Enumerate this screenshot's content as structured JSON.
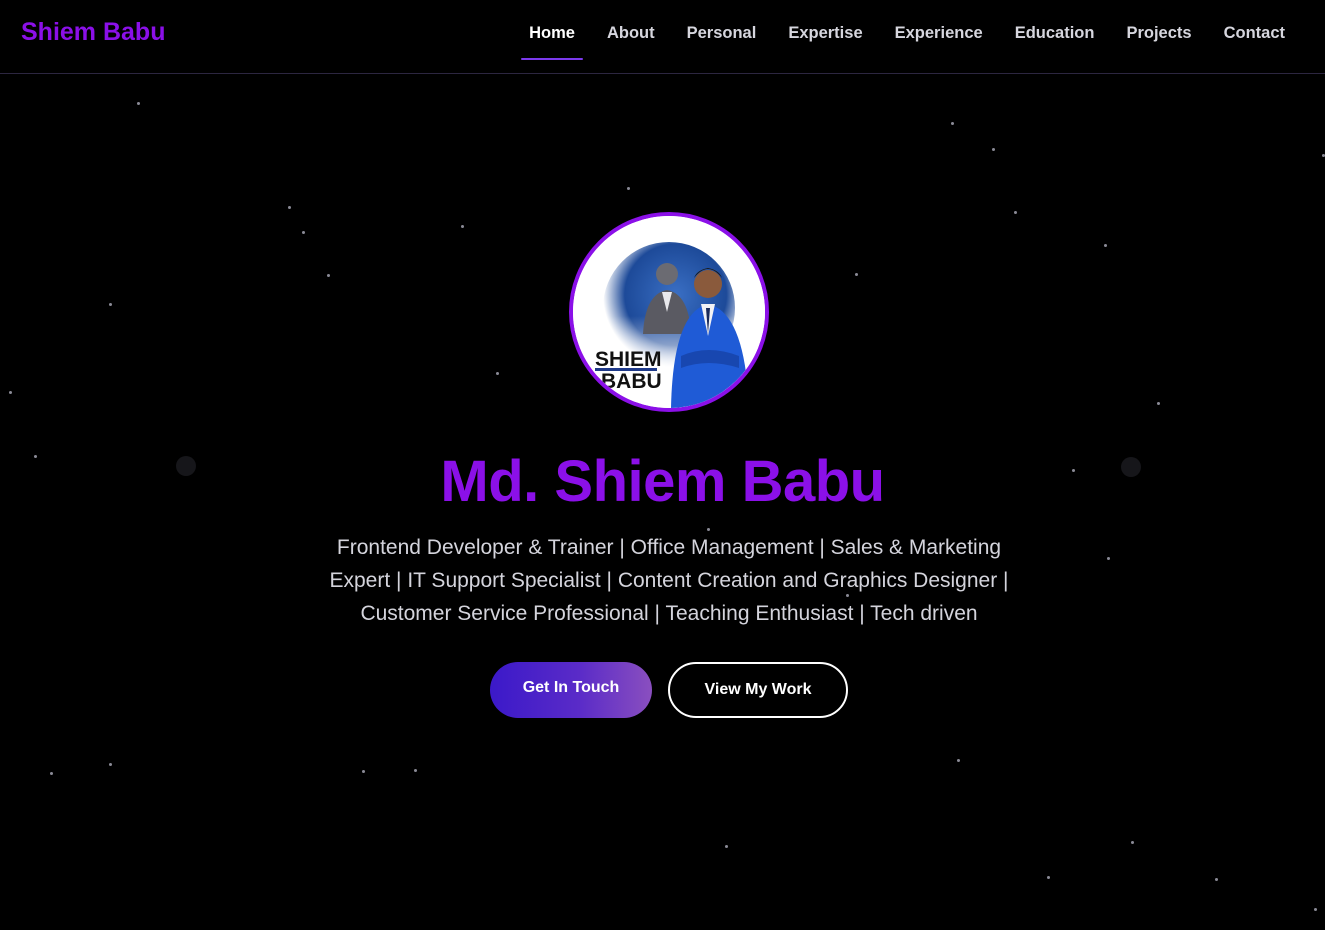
{
  "brand": {
    "name": "Shiem Babu"
  },
  "nav": {
    "items": [
      {
        "label": "Home",
        "active": true
      },
      {
        "label": "About",
        "active": false
      },
      {
        "label": "Personal",
        "active": false
      },
      {
        "label": "Expertise",
        "active": false
      },
      {
        "label": "Experience",
        "active": false
      },
      {
        "label": "Education",
        "active": false
      },
      {
        "label": "Projects",
        "active": false
      },
      {
        "label": "Contact",
        "active": false
      }
    ]
  },
  "hero": {
    "avatar_text_line1": "SHIEM",
    "avatar_text_line2": "BABU",
    "name": "Md. Shiem Babu",
    "tagline": "Frontend Developer & Trainer | Office Management | Sales & Marketing Expert | IT Support Specialist | Content Creation and Graphics Designer | Customer Service Professional | Teaching Enthusiast | Tech driven",
    "primary_button": "Get In Touch",
    "secondary_button": "View My Work"
  },
  "colors": {
    "background": "#000000",
    "accent": "#8b10e8",
    "text_muted": "#d4d4dc"
  }
}
